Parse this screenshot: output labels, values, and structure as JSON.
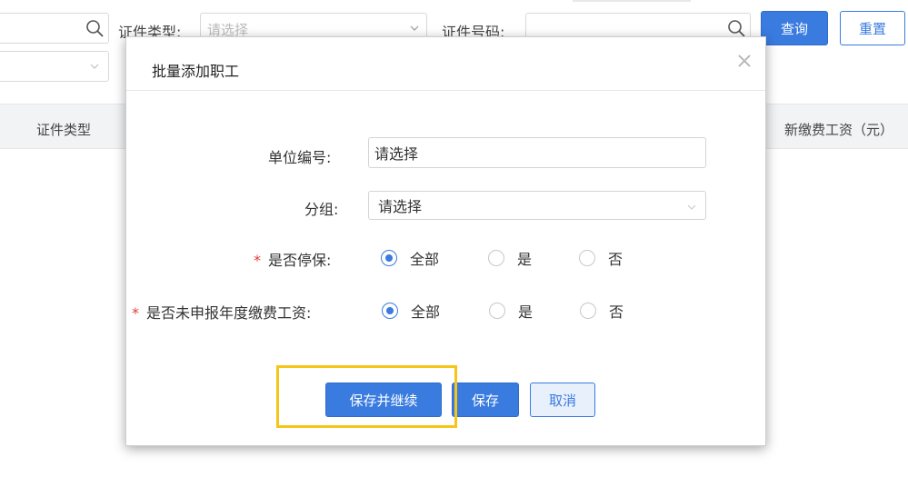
{
  "background": {
    "id_type_label": "证件类型:",
    "id_type_placeholder": "请选择",
    "id_number_label": "证件号码:",
    "query_button": "查询",
    "reset_button": "重置",
    "table_headers": {
      "id_type": "证件类型",
      "new_wage": "新缴费工资（元）"
    }
  },
  "modal": {
    "title": "批量添加职工",
    "close_icon": "close-icon",
    "fields": {
      "unit_number": {
        "label": "单位编号:",
        "value": "请选择"
      },
      "group": {
        "label": "分组:",
        "value": "请选择"
      }
    },
    "radio_groups": {
      "stop_insurance": {
        "required_mark": "*",
        "label": "是否停保:",
        "options": [
          "全部",
          "是",
          "否"
        ],
        "selected": "全部"
      },
      "annual_wage_unreported": {
        "required_mark": "*",
        "label": "是否未申报年度缴费工资:",
        "options": [
          "全部",
          "是",
          "否"
        ],
        "selected": "全部"
      }
    },
    "buttons": {
      "save_continue": "保存并继续",
      "save": "保存",
      "cancel": "取消"
    }
  },
  "colors": {
    "primary": "#3a7be0",
    "required": "#e03c3c",
    "highlight": "#f5c518"
  }
}
